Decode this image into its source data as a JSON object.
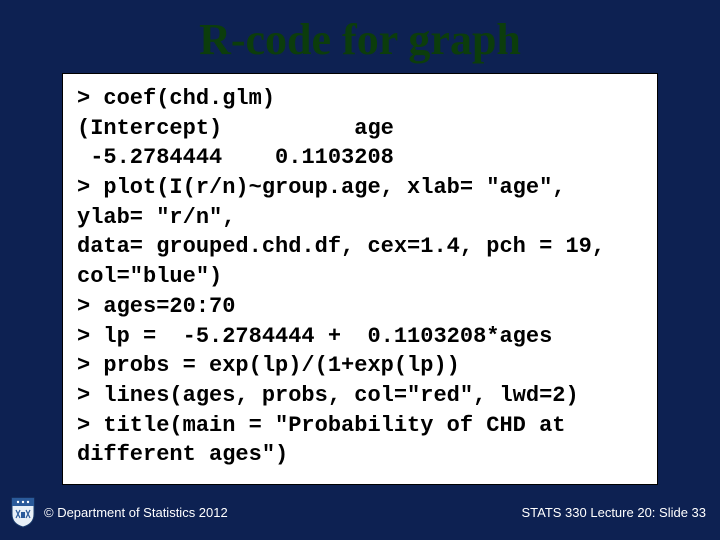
{
  "title": "R-code for graph",
  "code": "> coef(chd.glm)\n(Intercept)          age\n -5.2784444    0.1103208\n> plot(I(r/n)~group.age, xlab= \"age\", ylab= \"r/n\",\ndata= grouped.chd.df, cex=1.4, pch = 19, col=\"blue\")\n> ages=20:70\n> lp =  -5.2784444 +  0.1103208*ages\n> probs = exp(lp)/(1+exp(lp))\n> lines(ages, probs, col=\"red\", lwd=2)\n> title(main = \"Probability of CHD at different ages\")",
  "footer": {
    "copyright": "© Department of Statistics 2012",
    "pageinfo": "STATS 330 Lecture 20: Slide 33"
  }
}
